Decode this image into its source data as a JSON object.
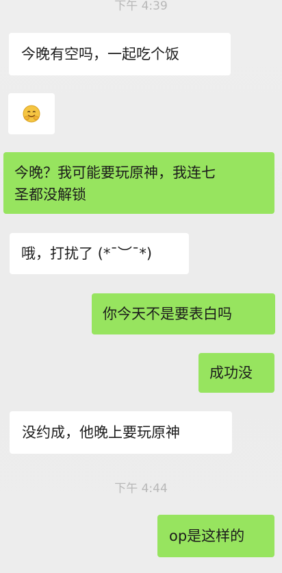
{
  "timestamps": [
    {
      "text": "下午 4:39"
    },
    {
      "text": "下午 4:44"
    }
  ],
  "messages": [
    {
      "side": "incoming",
      "text": "今晚有空吗，一起吃个饭"
    },
    {
      "side": "incoming",
      "emoji": "hugging-face-icon"
    },
    {
      "side": "outgoing",
      "text": "今晚？我可能要玩原神，我连七\n圣都没解锁"
    },
    {
      "side": "incoming",
      "text": "哦，打扰了 (*¯︶¯*)"
    },
    {
      "side": "outgoing",
      "text": "你今天不是要表白吗"
    },
    {
      "side": "outgoing",
      "text": "成功没"
    },
    {
      "side": "incoming",
      "text": "没约成，他晚上要玩原神"
    },
    {
      "side": "outgoing",
      "text": "op是这样的"
    }
  ],
  "colors": {
    "background": "#ececec",
    "incoming_bubble": "#ffffff",
    "outgoing_bubble": "#97e45f",
    "timestamp": "#b8b8b8",
    "text": "#1b1b1b"
  }
}
